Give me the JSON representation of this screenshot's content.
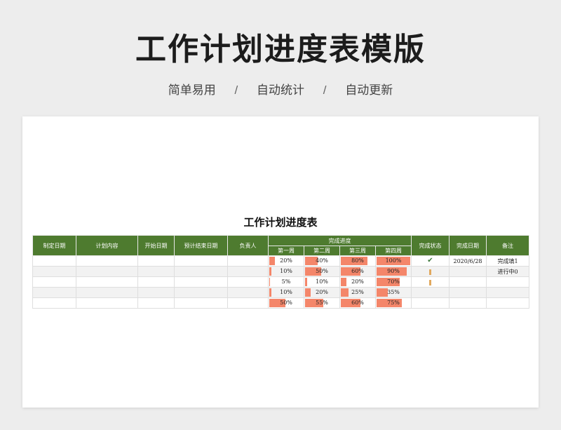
{
  "page": {
    "title": "工作计划进度表模版",
    "tagline": [
      "简单易用",
      "自动统计",
      "自动更新"
    ],
    "separator": "/"
  },
  "sheet": {
    "title": "工作计划进度表",
    "headers": {
      "date_set": "制定日期",
      "plan": "计划内容",
      "start": "开始日期",
      "end": "预计结束日期",
      "owner": "负责人",
      "progress": "完成进度",
      "weeks": [
        "第一周",
        "第二周",
        "第三周",
        "第四周"
      ],
      "status": "完成状态",
      "done_date": "完成日期",
      "note": "备注"
    },
    "rows": [
      {
        "progress": [
          "20%",
          "40%",
          "80%",
          "100%"
        ],
        "status_icon": "check-icon",
        "done_date": "2020/6/28",
        "note": "完成填1"
      },
      {
        "progress": [
          "10%",
          "50%",
          "60%",
          "90%"
        ],
        "status_icon": "flag-icon",
        "done_date": "",
        "note": "进行中0"
      },
      {
        "progress": [
          "5%",
          "10%",
          "20%",
          "70%"
        ],
        "status_icon": "flag-icon",
        "done_date": "",
        "note": ""
      },
      {
        "progress": [
          "10%",
          "20%",
          "25%",
          "35%"
        ],
        "status_icon": "",
        "done_date": "",
        "note": ""
      },
      {
        "progress": [
          "50%",
          "55%",
          "60%",
          "75%"
        ],
        "status_icon": "",
        "done_date": "",
        "note": ""
      }
    ],
    "colors": {
      "header_bg": "#4e7b2f",
      "bar": "#f4866a",
      "check": "#3f7a3f",
      "flag": "#e1a95f"
    }
  }
}
